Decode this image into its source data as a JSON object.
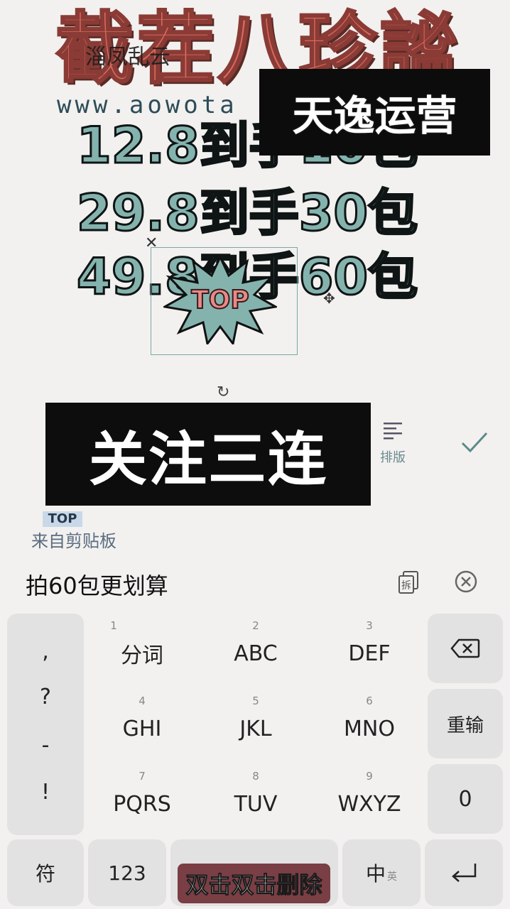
{
  "poster": {
    "title": "截茬八珍謐",
    "watermark_cn": "淄凤乱云",
    "watermark_url": "www.aowota",
    "brand_box": "天逸运营",
    "price_lines": [
      "12.8到手10包",
      "29.8到手30包",
      "49.8到手60包"
    ],
    "sticker_text": "TOP",
    "follow_box": "关注三连"
  },
  "editor": {
    "layout_label": "排版",
    "clipboard_thumb": "TOP",
    "clipboard_label": "来自剪贴板",
    "input_text": "拍60包更划算"
  },
  "keyboard": {
    "punct": [
      ",",
      "?",
      "-",
      "!"
    ],
    "keys": [
      {
        "digit": "1",
        "label": "分词"
      },
      {
        "digit": "2",
        "label": "ABC"
      },
      {
        "digit": "3",
        "label": "DEF"
      },
      {
        "digit": "4",
        "label": "GHI"
      },
      {
        "digit": "5",
        "label": "JKL"
      },
      {
        "digit": "6",
        "label": "MNO"
      },
      {
        "digit": "7",
        "label": "PQRS"
      },
      {
        "digit": "8",
        "label": "TUV"
      },
      {
        "digit": "9",
        "label": "WXYZ"
      }
    ],
    "reinput": "重输",
    "zero": "0",
    "symbol": "符",
    "num123": "123",
    "lang_main": "中",
    "lang_sub": "英",
    "space_overlay": "双击双击删除"
  },
  "colors": {
    "title": "#d8695f",
    "price_fill": "#84b3ae",
    "key_bg": "#e2e2e2",
    "page_bg": "#f2f1ef"
  }
}
